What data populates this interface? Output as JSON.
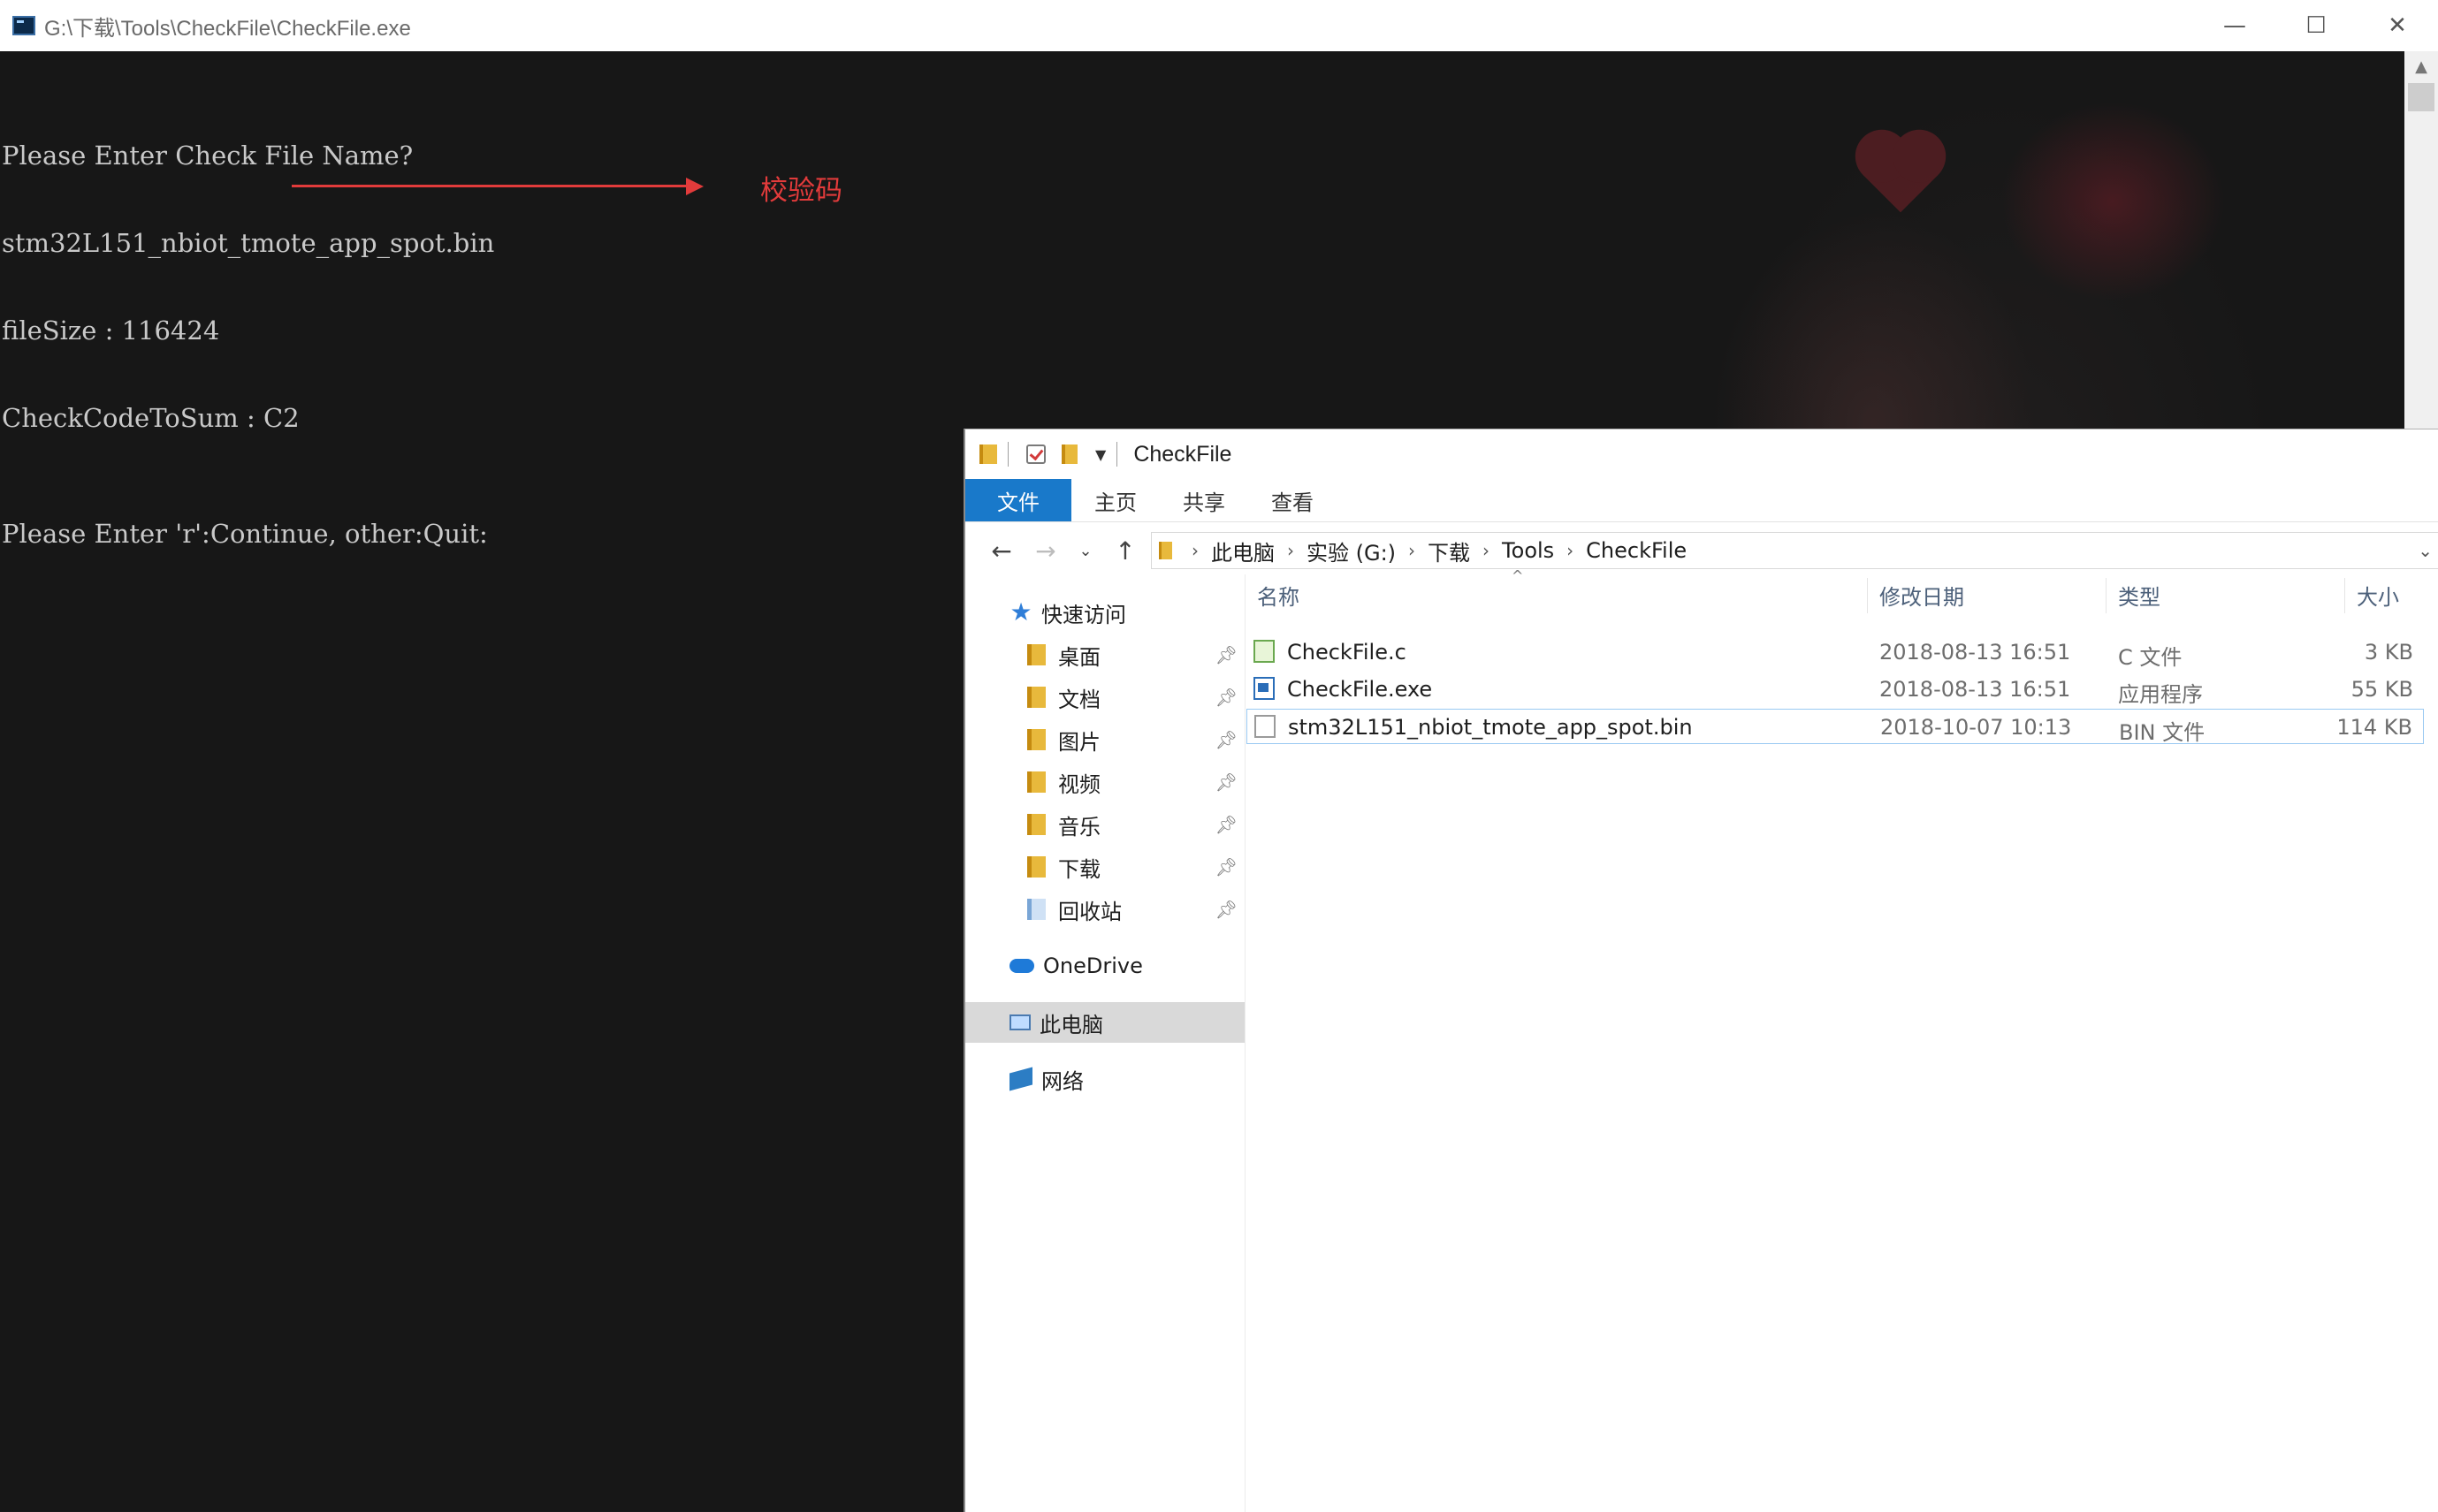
{
  "console": {
    "title": "G:\\下载\\Tools\\CheckFile\\CheckFile.exe",
    "controls": {
      "minimize": "—",
      "maximize": "☐",
      "close": "✕"
    },
    "lines": [
      "Please Enter Check File Name?",
      "stm32L151_nbiot_tmote_app_spot.bin",
      "fileSize : 116424",
      "CheckCodeToSum : C2",
      "Please Enter 'r':Continue, other:Quit:"
    ],
    "annotation": "校验码",
    "annotation_color": "#e23b3b"
  },
  "explorer": {
    "title": "CheckFile",
    "ribbon_tabs": [
      "文件",
      "主页",
      "共享",
      "查看"
    ],
    "nav": {
      "back": "←",
      "forward": "→",
      "recent": "⌄",
      "up": "↑"
    },
    "breadcrumb": [
      "此电脑",
      "实验 (G:)",
      "下载",
      "Tools",
      "CheckFile"
    ],
    "sidebar": {
      "quick_access": "快速访问",
      "items": [
        {
          "label": "桌面"
        },
        {
          "label": "文档"
        },
        {
          "label": "图片"
        },
        {
          "label": "视频"
        },
        {
          "label": "音乐"
        },
        {
          "label": "下载"
        },
        {
          "label": "回收站"
        }
      ],
      "onedrive": "OneDrive",
      "this_pc": "此电脑",
      "network": "网络"
    },
    "columns": {
      "name": "名称",
      "modified": "修改日期",
      "type": "类型",
      "size": "大小"
    },
    "files": [
      {
        "name": "CheckFile.c",
        "modified": "2018-08-13 16:51",
        "type": "C 文件",
        "size": "3 KB",
        "icon": "c-source-file-icon"
      },
      {
        "name": "CheckFile.exe",
        "modified": "2018-08-13 16:51",
        "type": "应用程序",
        "size": "55 KB",
        "icon": "exe-file-icon"
      },
      {
        "name": "stm32L151_nbiot_tmote_app_spot.bin",
        "modified": "2018-10-07 10:13",
        "type": "BIN 文件",
        "size": "114 KB",
        "icon": "bin-file-icon"
      }
    ],
    "accent_color": "#1979ca"
  }
}
